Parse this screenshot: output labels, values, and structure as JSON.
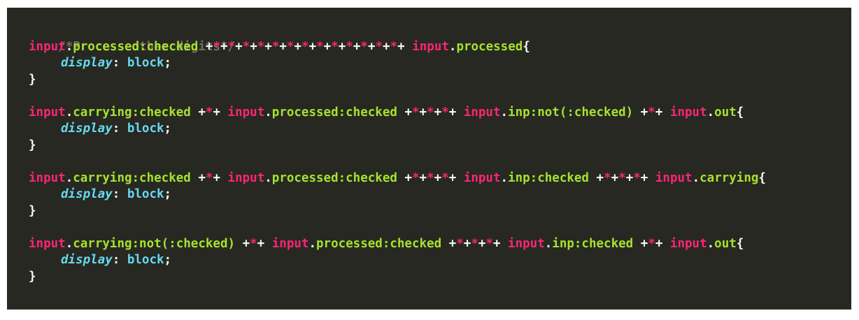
{
  "editor": {
    "comment": "/*Process other digits*/",
    "rules": [
      {
        "selector": [
          {
            "k": "tag",
            "t": "input"
          },
          {
            "k": "dot",
            "t": "."
          },
          {
            "k": "cls",
            "t": "processed:checked"
          },
          {
            "k": "sp",
            "t": " "
          },
          {
            "k": "combo",
            "t": "+*+*+*+*+*+*+*+*+*+*+*+*+*+"
          },
          {
            "k": "sp",
            "t": " "
          },
          {
            "k": "tag",
            "t": "input"
          },
          {
            "k": "dot",
            "t": "."
          },
          {
            "k": "cls",
            "t": "processed"
          },
          {
            "k": "punc",
            "t": "{"
          }
        ],
        "property": "display",
        "value": "block",
        "close": "}"
      },
      {
        "selector": [
          {
            "k": "tag",
            "t": "input"
          },
          {
            "k": "dot",
            "t": "."
          },
          {
            "k": "cls",
            "t": "carrying:checked"
          },
          {
            "k": "sp",
            "t": " "
          },
          {
            "k": "combo",
            "t": "+*+"
          },
          {
            "k": "sp",
            "t": " "
          },
          {
            "k": "tag",
            "t": "input"
          },
          {
            "k": "dot",
            "t": "."
          },
          {
            "k": "cls",
            "t": "processed:checked"
          },
          {
            "k": "sp",
            "t": " "
          },
          {
            "k": "combo",
            "t": "+*+*+*+"
          },
          {
            "k": "sp",
            "t": " "
          },
          {
            "k": "tag",
            "t": "input"
          },
          {
            "k": "dot",
            "t": "."
          },
          {
            "k": "cls",
            "t": "inp:not(:checked)"
          },
          {
            "k": "sp",
            "t": " "
          },
          {
            "k": "combo",
            "t": "+*+"
          },
          {
            "k": "sp",
            "t": " "
          },
          {
            "k": "tag",
            "t": "input"
          },
          {
            "k": "dot",
            "t": "."
          },
          {
            "k": "cls",
            "t": "out"
          },
          {
            "k": "punc",
            "t": "{"
          }
        ],
        "property": "display",
        "value": "block",
        "close": "}"
      },
      {
        "selector": [
          {
            "k": "tag",
            "t": "input"
          },
          {
            "k": "dot",
            "t": "."
          },
          {
            "k": "cls",
            "t": "carrying:checked"
          },
          {
            "k": "sp",
            "t": " "
          },
          {
            "k": "combo",
            "t": "+*+"
          },
          {
            "k": "sp",
            "t": " "
          },
          {
            "k": "tag",
            "t": "input"
          },
          {
            "k": "dot",
            "t": "."
          },
          {
            "k": "cls",
            "t": "processed:checked"
          },
          {
            "k": "sp",
            "t": " "
          },
          {
            "k": "combo",
            "t": "+*+*+*+"
          },
          {
            "k": "sp",
            "t": " "
          },
          {
            "k": "tag",
            "t": "input"
          },
          {
            "k": "dot",
            "t": "."
          },
          {
            "k": "cls",
            "t": "inp:checked"
          },
          {
            "k": "sp",
            "t": " "
          },
          {
            "k": "combo",
            "t": "+*+*+*+"
          },
          {
            "k": "sp",
            "t": " "
          },
          {
            "k": "tag",
            "t": "input"
          },
          {
            "k": "dot",
            "t": "."
          },
          {
            "k": "cls",
            "t": "carrying"
          },
          {
            "k": "punc",
            "t": "{"
          }
        ],
        "property": "display",
        "value": "block",
        "close": "}"
      },
      {
        "selector": [
          {
            "k": "tag",
            "t": "input"
          },
          {
            "k": "dot",
            "t": "."
          },
          {
            "k": "cls",
            "t": "carrying:not(:checked)"
          },
          {
            "k": "sp",
            "t": " "
          },
          {
            "k": "combo",
            "t": "+*+"
          },
          {
            "k": "sp",
            "t": " "
          },
          {
            "k": "tag",
            "t": "input"
          },
          {
            "k": "dot",
            "t": "."
          },
          {
            "k": "cls",
            "t": "processed:checked"
          },
          {
            "k": "sp",
            "t": " "
          },
          {
            "k": "combo",
            "t": "+*+*+*+"
          },
          {
            "k": "sp",
            "t": " "
          },
          {
            "k": "tag",
            "t": "input"
          },
          {
            "k": "dot",
            "t": "."
          },
          {
            "k": "cls",
            "t": "inp:checked"
          },
          {
            "k": "sp",
            "t": " "
          },
          {
            "k": "combo",
            "t": "+*+"
          },
          {
            "k": "sp",
            "t": " "
          },
          {
            "k": "tag",
            "t": "input"
          },
          {
            "k": "dot",
            "t": "."
          },
          {
            "k": "cls",
            "t": "out"
          },
          {
            "k": "punc",
            "t": "{"
          }
        ],
        "property": "display",
        "value": "block",
        "close": "}"
      }
    ],
    "colors": {
      "background": "#272822",
      "comment": "#75715e",
      "tag": "#f92672",
      "class": "#a6e22e",
      "property": "#66d9ef",
      "text": "#f8f8f2"
    }
  }
}
